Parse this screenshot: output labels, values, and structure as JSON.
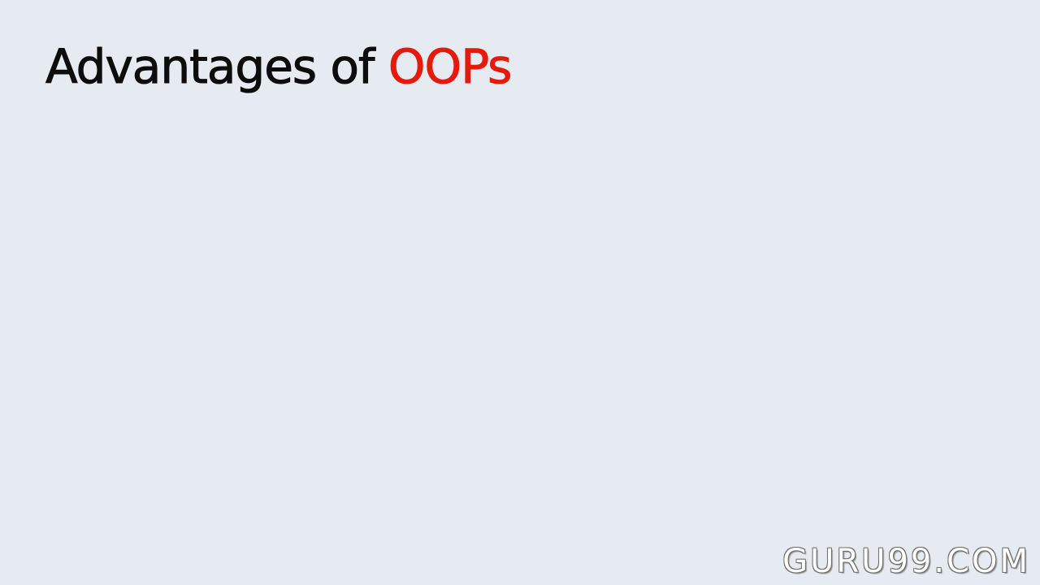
{
  "slide": {
    "title_prefix": "Advantages of ",
    "title_accent": "OOPs",
    "watermark": "GURU99.COM"
  },
  "colors": {
    "background": "#e6ebf2",
    "title": "#0d0d0d",
    "accent": "#e41a0c",
    "watermark_fill": "#ffffff",
    "watermark_outline": "#6d6d6d"
  }
}
